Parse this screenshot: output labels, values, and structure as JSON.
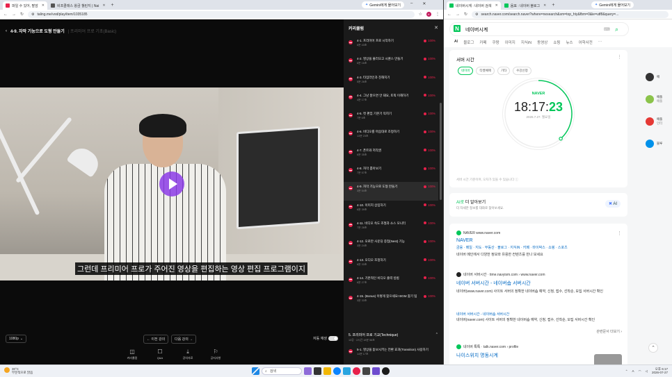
{
  "left_window": {
    "tabs": [
      {
        "label": "파일 수 있어, 팔암",
        "favicon_color": "#e8214b",
        "active": true
      },
      {
        "label": "비프클래스 왕금 챌린지 | Nai",
        "favicon_color": "#555555",
        "active": false
      }
    ],
    "gemini_label": "Gemini에게 물어보기",
    "url": "taling.me/vod/play/item/1035185",
    "avatar_letter": "K"
  },
  "player": {
    "back_icon": "chevron-left-icon",
    "title": "4-9. 자막 기능으로 도형 만들기",
    "title_sub": "| 프리미어 프로 기초(Basic)",
    "subtitle": "그런데 프리미어 프로가 주어진 영상을 편집하는 영상 편집 프로그램이지",
    "quality": "1080p",
    "prev_label": "← 이전 강의",
    "next_label": "다음 강의 →",
    "autoplay_label": "자동 재생",
    "bottom_nav": [
      {
        "label": "커리큘럼",
        "icon": "curriculum-icon",
        "glyph": "◫"
      },
      {
        "label": "Q&A",
        "icon": "qna-icon",
        "glyph": "☐"
      },
      {
        "label": "강의자료",
        "icon": "download-icon",
        "glyph": "⤓"
      },
      {
        "label": "공지사항",
        "icon": "notice-icon",
        "glyph": "⚐"
      }
    ]
  },
  "curriculum": {
    "title": "커리큘럼",
    "items": [
      {
        "title": "4-1. 프리미어 프로 시작하기",
        "meta": "6분 43초",
        "pct": "100%"
      },
      {
        "title": "4-2. 영상을 불러오고 시퀀스 만들기",
        "meta": "6분 16초",
        "pct": "100%"
      },
      {
        "title": "4-3. 타임라인과 친해지기",
        "meta": "5분 26초",
        "pct": "100%"
      },
      {
        "title": "4-4. 그냥 잘으면 안 돼요, 토픽 이해하기",
        "meta": "4분 17초",
        "pct": "100%"
      },
      {
        "title": "4-5. 컷 편집 기본기 익히기",
        "meta": "7분 6초",
        "pct": "100%"
      },
      {
        "title": "4-6. 비디오를 마음대로 조정하기",
        "meta": "13분 23초",
        "pct": "100%"
      },
      {
        "title": "4-7. 폰트와 저작권",
        "meta": "6분 35초",
        "pct": "100%"
      },
      {
        "title": "4-8. 자막 뽑아보기",
        "meta": "7분 57초",
        "pct": "100%"
      },
      {
        "title": "4-9. 자막 기능으로 도형 만들기",
        "meta": "3분 54초",
        "pct": "100%"
      },
      {
        "title": "4-10. 이미지 삽입하기",
        "meta": "6분 39초",
        "pct": "100%"
      },
      {
        "title": "4-11. 비디오 속도 조절과 소스 모니터",
        "meta": "7분 28초",
        "pct": "100%"
      },
      {
        "title": "4-12. 오로만 사운딩 중첩(Nest) 기능",
        "meta": "3분 24초",
        "pct": "100%"
      },
      {
        "title": "4-13. 오디오 조정하기",
        "meta": "6분 33초",
        "pct": "100%"
      },
      {
        "title": "4-14. 기본적인 비디오 출력 방법",
        "meta": "6분 27초",
        "pct": "100%"
      },
      {
        "title": "4-15. (Bonus) 이렇게 찾으세요! BGM 찾기 팁",
        "meta": "3분 33초",
        "pct": "100%"
      }
    ],
    "active_index": 8,
    "section5_title": "5. 프리미어 프로 기교(Technique)",
    "section5_meta": "13강 · 2시간 18분 56초",
    "section5_first": "5-1. 영상을 돋보시키는 전환 효과(Transition) 사용하기",
    "section5_first_meta": "14분 17초"
  },
  "right_window": {
    "tabs": [
      {
        "label": "네이버시계 : 네이버 검색",
        "favicon_color": "#03c75a",
        "active": true
      },
      {
        "label": "음표 : 네이버 블로그",
        "favicon_color": "#03c75a",
        "active": false
      }
    ],
    "gemini_label": "Gemini에게 물어보기",
    "url": "search.naver.com/search.naver?where=nexearch&sm=top_hty&fbm=0&ie=utf8&query=..."
  },
  "naver": {
    "logo": "N",
    "query": "네이버시계",
    "tabs": [
      "AI",
      "블로그",
      "카페",
      "쿠팡",
      "이미지",
      "지식iN",
      "동영상",
      "쇼핑",
      "뉴스",
      "어학사전",
      "···"
    ],
    "clock": {
      "card_title": "서버 시간",
      "chips": [
        "네이버",
        "티켓예매",
        "기타",
        "수강신청"
      ],
      "brand": "NAVER",
      "time_hm": "18:17:",
      "time_s": "23",
      "seconds": 23,
      "date": "2026.7.27. 월요일",
      "note": "서버 시간 기준이며, 오차가 있을 수 있습니다"
    },
    "ai_card": {
      "title_prefix": "AI로",
      "title": " 더 알아보기",
      "sub": "더 자세한 정보를 대화로 찾아보세요.",
      "button": "AI"
    },
    "results": [
      {
        "source": "NAVER  www.naver.com",
        "title": "NAVER",
        "links": "금융 · 메일 · 지도 · 부동산 · 블로그 · 지식iN · 카페 · 마이박스 · 쇼핑 · 스포츠",
        "desc": "네이버 메인에서 다양한 정보와 유용한 컨텐츠를 만나 보세요"
      },
      {
        "source": "네이버 서버시간 · time.navyism.com › www.naver.com",
        "title": "네이버 서버시간 - 네이버숍 서버시간",
        "desc": "네이버(www.naver.com) 사이트 서버의 정확한 네이버숍 예약, 신청, 접수, 선착순, 모집 서버시간 확인"
      },
      {
        "source": "",
        "title": "네이버 서버시간 - 네이버숍 서버시간",
        "desc": "네이버(naver.com) 사이트 서버의 정확한 네이버숍 예약, 신청, 접수, 선착순, 모집 서버시간 확인"
      },
      {
        "source": "네이버 톡톡 · talk.naver.com › profile",
        "title": "나이스위치 명동시계",
        "desc": ""
      }
    ],
    "more_label": "관련문서 더보기 ›",
    "side_panel": [
      {
        "label": "애",
        "sub": "",
        "color": "#333333"
      },
      {
        "label": "애플",
        "sub": "애플",
        "color": "#8bc34a"
      },
      {
        "label": "애플",
        "sub": "인터",
        "color": "#e53935"
      },
      {
        "label": "블루",
        "sub": "",
        "color": "#0091ea"
      }
    ]
  },
  "taskbar": {
    "weather_temp": "30°C",
    "weather_desc": "부분적으로 맑음",
    "search_placeholder": "검색",
    "time": "오후 6:17",
    "date": "2026-07-27",
    "ime": "A"
  }
}
